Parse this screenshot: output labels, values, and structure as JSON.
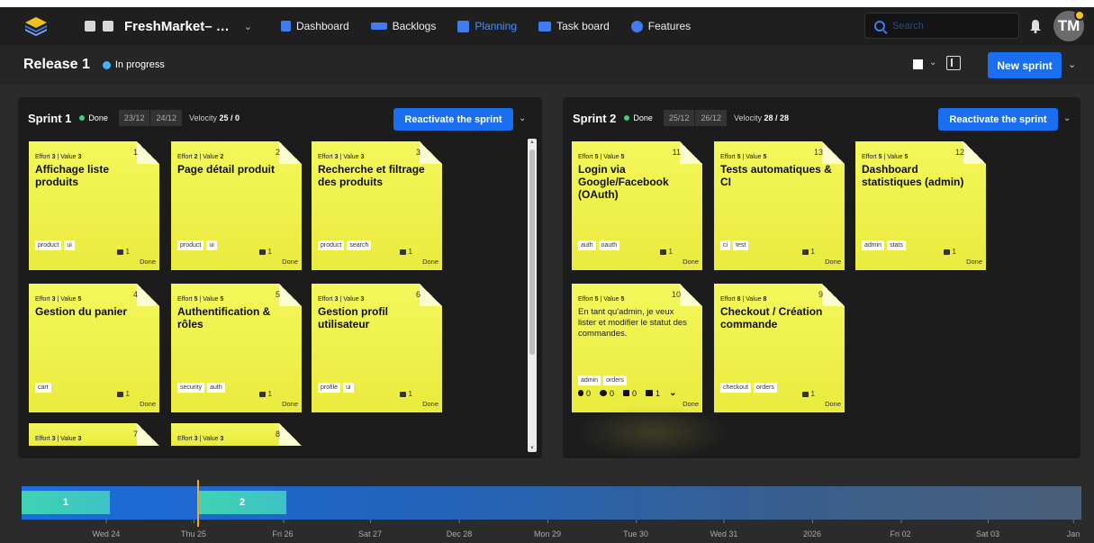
{
  "navbar": {
    "project_name": "FreshMarket– …",
    "links": [
      {
        "label": "Dashboard",
        "icon": "dashboard-icon",
        "color": "#3e7cf0"
      },
      {
        "label": "Backlogs",
        "icon": "backlogs-icon",
        "color": "#3e7cf0"
      },
      {
        "label": "Planning",
        "icon": "planning-icon",
        "color": "#3e7cf0",
        "active": true
      },
      {
        "label": "Task board",
        "icon": "taskboard-icon",
        "color": "#3e7cf0"
      },
      {
        "label": "Features",
        "icon": "features-icon",
        "color": "#3e7cf0"
      }
    ],
    "search_placeholder": "Search",
    "avatar_initials": "TM"
  },
  "release": {
    "title": "Release 1",
    "status": "In progress",
    "new_sprint_label": "New sprint"
  },
  "sprints": [
    {
      "title": "Sprint 1",
      "status": "Done",
      "start": "23/12",
      "end": "24/12",
      "velocity_label": "Velocity",
      "velocity": "25 / 0",
      "action_label": "Reactivate the sprint"
    },
    {
      "title": "Sprint 2",
      "status": "Done",
      "start": "25/12",
      "end": "26/12",
      "velocity_label": "Velocity",
      "velocity": "28 / 28",
      "action_label": "Reactivate the sprint"
    }
  ],
  "sprint1_cards": [
    {
      "num": "1",
      "effort": "3",
      "value": "3",
      "title": "Affichage liste produits",
      "tags": [
        "product",
        "ui"
      ],
      "tasks": "1",
      "status": "Done"
    },
    {
      "num": "2",
      "effort": "2",
      "value": "2",
      "title": "Page détail produit",
      "tags": [
        "product",
        "ui"
      ],
      "tasks": "1",
      "status": "Done"
    },
    {
      "num": "3",
      "effort": "3",
      "value": "3",
      "title": "Recherche et filtrage des produits",
      "tags": [
        "product",
        "search"
      ],
      "tasks": "1",
      "status": "Done"
    },
    {
      "num": "4",
      "effort": "3",
      "value": "5",
      "title": "Gestion du panier",
      "tags": [
        "cart"
      ],
      "tasks": "1",
      "status": "Done"
    },
    {
      "num": "5",
      "effort": "5",
      "value": "5",
      "title": "Authentification & rôles",
      "tags": [
        "security",
        "auth"
      ],
      "tasks": "1",
      "status": "Done"
    },
    {
      "num": "6",
      "effort": "3",
      "value": "3",
      "title": "Gestion profil utilisateur",
      "tags": [
        "profile",
        "ui"
      ],
      "tasks": "1",
      "status": "Done"
    },
    {
      "num": "7",
      "effort": "3",
      "value": "3"
    },
    {
      "num": "8",
      "effort": "3",
      "value": "3"
    }
  ],
  "sprint2_cards": [
    {
      "num": "11",
      "effort": "5",
      "value": "5",
      "title": "Login via Google/Facebook (OAuth)",
      "tags": [
        "auth",
        "oauth"
      ],
      "tasks": "1",
      "status": "Done"
    },
    {
      "num": "13",
      "effort": "5",
      "value": "5",
      "title": "Tests automatiques & CI",
      "tags": [
        "ci",
        "test"
      ],
      "tasks": "1",
      "status": "Done"
    },
    {
      "num": "12",
      "effort": "5",
      "value": "5",
      "title": "Dashboard statistiques (admin)",
      "tags": [
        "admin",
        "stats"
      ],
      "tasks": "1",
      "status": "Done"
    },
    {
      "num": "10",
      "effort": "5",
      "value": "5",
      "description": "En tant qu'admin, je veux lister et modifier le statut des commandes.",
      "tags": [
        "admin",
        "orders"
      ],
      "stats": {
        "attachments": "0",
        "comments": "0",
        "checks": "0",
        "tasks": "1"
      },
      "status": "Done"
    },
    {
      "num": "9",
      "effort": "8",
      "value": "8",
      "title": "Checkout / Création commande",
      "tags": [
        "checkout",
        "orders"
      ],
      "tasks": "1",
      "status": "Done"
    }
  ],
  "labels": {
    "effort": "Effort",
    "value": "Value"
  },
  "timeline": {
    "sprints": [
      {
        "label": "1"
      },
      {
        "label": "2"
      }
    ],
    "ticks": [
      "Wed 24",
      "Thu 25",
      "Fri 26",
      "Sat 27",
      "Dec 28",
      "Mon 29",
      "Tue 30",
      "Wed 31",
      "2026",
      "Fri 02",
      "Sat 03",
      "Jan"
    ]
  }
}
